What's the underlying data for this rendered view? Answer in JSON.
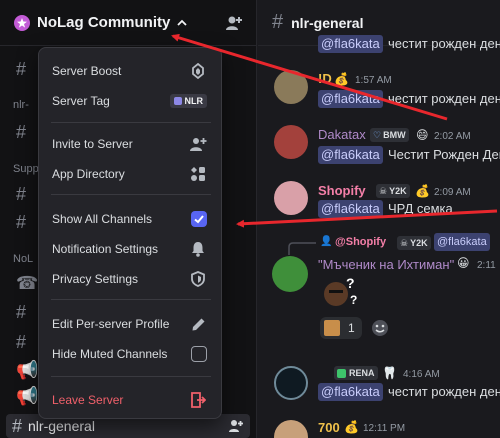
{
  "server": {
    "name": "NoLag Community"
  },
  "sidebar": {
    "bg_categories": [
      "nlr-",
      "Supp",
      "NoL"
    ],
    "bottom_channel": "nlr-general"
  },
  "menu": {
    "items": [
      {
        "label": "Server Boost",
        "icon": "boost-gem-icon"
      },
      {
        "label": "Server Tag",
        "icon": "tag-badge-icon",
        "badge": "NLR"
      },
      {
        "label": "Invite to Server",
        "icon": "add-user-icon"
      },
      {
        "label": "App Directory",
        "icon": "app-grid-icon"
      },
      {
        "label": "Show All Channels",
        "icon": "checkbox-icon",
        "checked": true
      },
      {
        "label": "Notification Settings",
        "icon": "bell-icon"
      },
      {
        "label": "Privacy Settings",
        "icon": "shield-icon"
      },
      {
        "label": "Edit Per-server Profile",
        "icon": "pencil-icon"
      },
      {
        "label": "Hide Muted Channels",
        "icon": "checkbox-icon",
        "checked": false
      },
      {
        "label": "Leave Server",
        "icon": "leave-door-icon",
        "danger": true
      }
    ]
  },
  "channel": {
    "name": "nlr-general"
  },
  "messages": [
    {
      "mention": "@fla6kata",
      "text": "честит рожден ден"
    },
    {
      "user": "!D",
      "time": "1:57 AM",
      "mention": "@fla6kata",
      "text": "честит рожден ден"
    },
    {
      "user": "Dakatax",
      "badge": "BMW",
      "time": "2:02 AM",
      "mention": "@fla6kata",
      "text": "Честит Рожден Ден"
    },
    {
      "user": "Shopify",
      "badge": "Y2K",
      "time": "2:09 AM",
      "mention": "@fla6kata",
      "text": "ЧРД семка"
    },
    {
      "reply": {
        "user": "@Shopify",
        "badge": "Y2K",
        "mention": "@fla6kata"
      },
      "user": "\"Мъченик на Ихтиман\"",
      "time": "2:11",
      "reaction_count": "1"
    },
    {
      "badge": "RENA",
      "time": "4:16 AM",
      "mention": "@fla6kata",
      "text": "честит рожден ден"
    },
    {
      "user": "700",
      "time": "12:11 PM"
    }
  ],
  "colors": {
    "accent": "#5865f2",
    "danger": "#f0606a",
    "mention_bg": "#3c4270",
    "annotation": "#e8272d"
  }
}
